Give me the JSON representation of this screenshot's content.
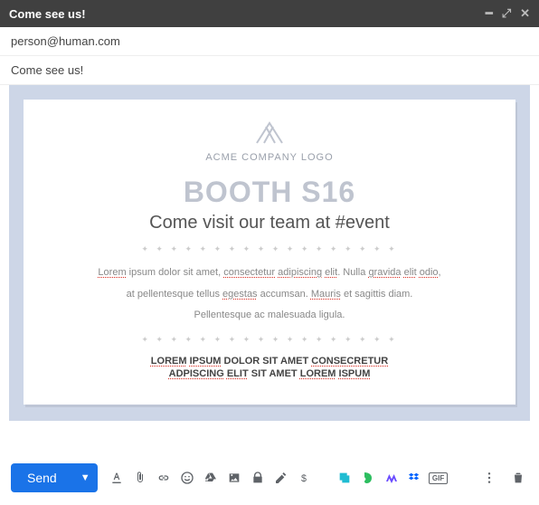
{
  "window": {
    "title": "Come see us!"
  },
  "recipient": "person@human.com",
  "subject": "Come see us!",
  "card": {
    "logo_text": "ACME COMPANY LOGO",
    "booth": "BOOTH S16",
    "tagline": "Come visit our team at #event",
    "separator": "✦ ✦ ✦ ✦ ✦ ✦ ✦ ✦ ✦ ✦ ✦ ✦ ✦ ✦ ✦ ✦ ✦ ✦",
    "p1_a": "Lorem",
    "p1_b": " ipsum dolor sit amet, ",
    "p1_c": "consectetur",
    "p1_d": " ",
    "p1_e": "adipiscing",
    "p1_f": " ",
    "p1_g": "elit",
    "p1_h": ". Nulla ",
    "p1_i": "gravida",
    "p1_j": " ",
    "p1_k": "elit",
    "p1_l": " ",
    "p1_m": "odio",
    "p1_n": ",",
    "p2_a": "at pellentesque tellus ",
    "p2_b": "egestas",
    "p2_c": " accumsan. ",
    "p2_d": "Mauris",
    "p2_e": " et sagittis diam.",
    "p3": "Pellentesque ac malesuada ligula.",
    "b1_a": "LOREM",
    "b1_b": " ",
    "b1_c": "IPSUM",
    "b1_d": " DOLOR SIT AMET ",
    "b1_e": "CONSECRETUR",
    "b2_a": "ADPISCING",
    "b2_b": " ",
    "b2_c": "ELIT",
    "b2_d": " SIT AMET ",
    "b2_e": "LOREM",
    "b2_f": " ",
    "b2_g": "ISPUM"
  },
  "toolbar": {
    "send_label": "Send",
    "gif_label": "GIF"
  },
  "colors": {
    "accent": "#1a73e8",
    "canvas": "#cdd6e7",
    "muted": "#bfc4cf",
    "boxbee": "#1fbcd2",
    "evernote": "#2dbe60",
    "mixmax": "#6a4cff",
    "dropbox": "#0061ff"
  }
}
